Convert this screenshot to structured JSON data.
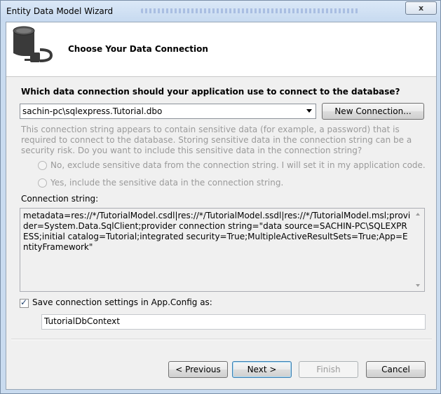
{
  "window": {
    "title": "Entity Data Model Wizard",
    "close_glyph": "x"
  },
  "header": {
    "title": "Choose Your Data Connection",
    "icon": "database-plug-icon"
  },
  "connection": {
    "question": "Which data connection should your application use to connect to the database?",
    "selected": "sachin-pc\\sqlexpress.Tutorial.dbo",
    "new_connection_label": "New Connection..."
  },
  "sensitive": {
    "text": "This connection string appears to contain sensitive data (for example, a password) that is required to connect to the database. Storing sensitive data in the connection string can be a security risk. Do you want to include this sensitive data in the connection string?",
    "option_no": "No, exclude sensitive data from the connection string. I will set it in my application code.",
    "option_yes": "Yes, include the sensitive data in the connection string."
  },
  "connection_string": {
    "label": "Connection string:",
    "value": "metadata=res://*/TutorialModel.csdl|res://*/TutorialModel.ssdl|res://*/TutorialModel.msl;provider=System.Data.SqlClient;provider connection string=\"data source=SACHIN-PC\\SQLEXPRESS;initial catalog=Tutorial;integrated security=True;MultipleActiveResultSets=True;App=EntityFramework\""
  },
  "save": {
    "checked": true,
    "label": "Save connection settings in App.Config as:",
    "name": "TutorialDbContext"
  },
  "buttons": {
    "previous": "< Previous",
    "next": "Next >",
    "finish": "Finish",
    "cancel": "Cancel"
  },
  "colors": {
    "title_bar": "#c9dbef",
    "disabled_text": "#9a9a9a",
    "default_button_border": "#3c7fb1"
  }
}
